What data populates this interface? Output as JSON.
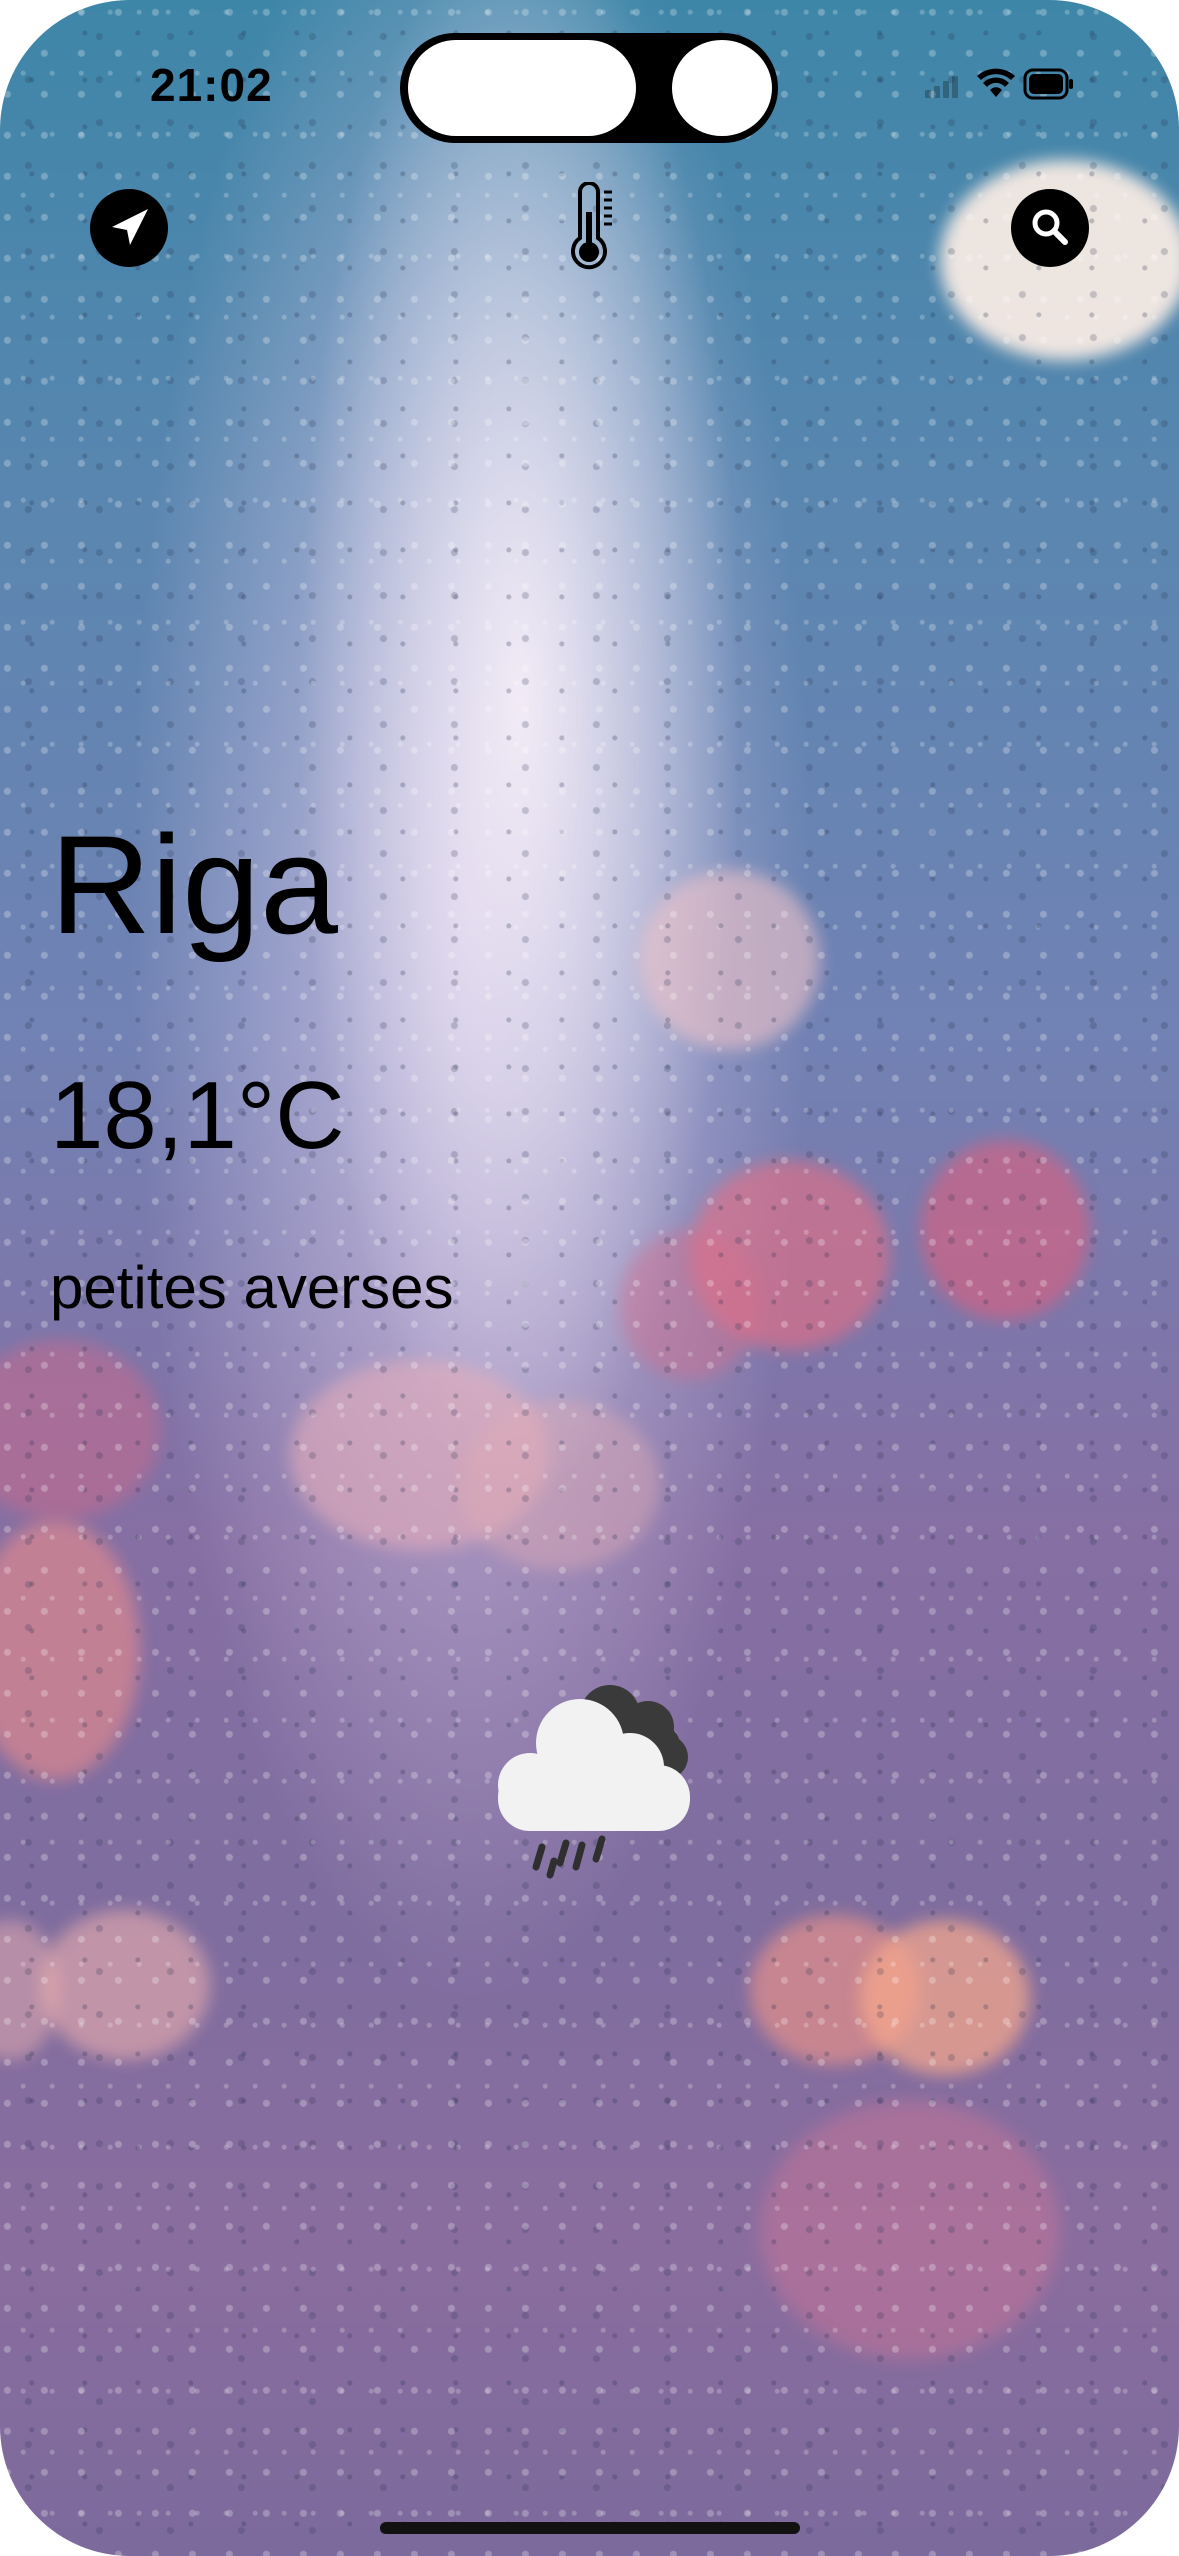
{
  "status_bar": {
    "time": "21:02",
    "signal_icon": "cellular-signal-icon",
    "wifi_icon": "wifi-icon",
    "battery_icon": "battery-icon"
  },
  "toolbar": {
    "location_icon": "location-arrow-icon",
    "unit_icon": "thermometer-icon",
    "search_icon": "search-icon"
  },
  "weather": {
    "city": "Riga",
    "temperature": "18,1°C",
    "description": "petites averses",
    "condition_icon": "cloud-rain-icon"
  },
  "colors": {
    "text": "#000000",
    "button_bg": "#000000",
    "button_fg": "#ffffff"
  }
}
